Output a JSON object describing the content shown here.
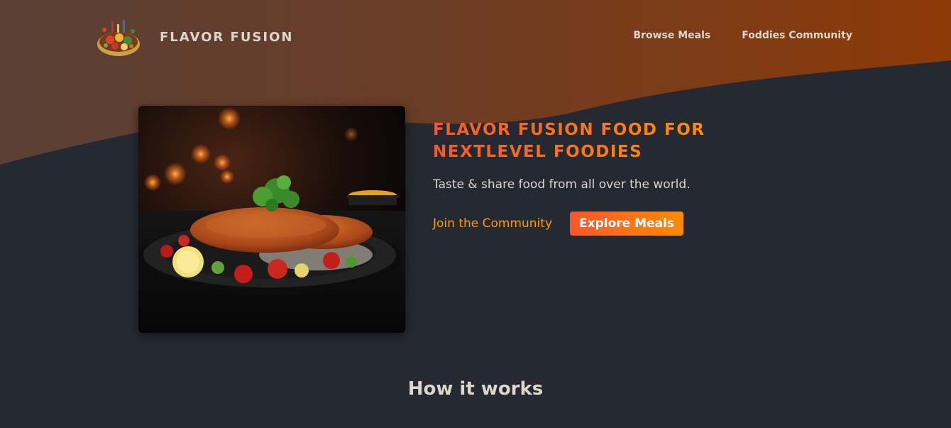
{
  "header": {
    "logo_alt": "A plate with food on it",
    "logo_text": "FLAVOR FUSION",
    "nav": [
      {
        "label": "Browse Meals"
      },
      {
        "label": "Foddies Community"
      }
    ]
  },
  "hero": {
    "image_alt": "Breaded schnitzel with tomatoes and lemon on a black plate",
    "title": "FLAVOR FUSION FOOD FOR NEXTLEVEL FOODIES",
    "subtitle": "Taste & share food from all over the world.",
    "community_link": "Join the Community",
    "explore_button": "Explore Meals"
  },
  "how_it_works": {
    "title": "How it works"
  },
  "colors": {
    "background": "#252931",
    "text": "#ddd6cb",
    "accent_start": "#f9572a",
    "accent_end": "#ff9b05",
    "wave_left": "#5a4036",
    "wave_right": "#8a3a0c"
  }
}
